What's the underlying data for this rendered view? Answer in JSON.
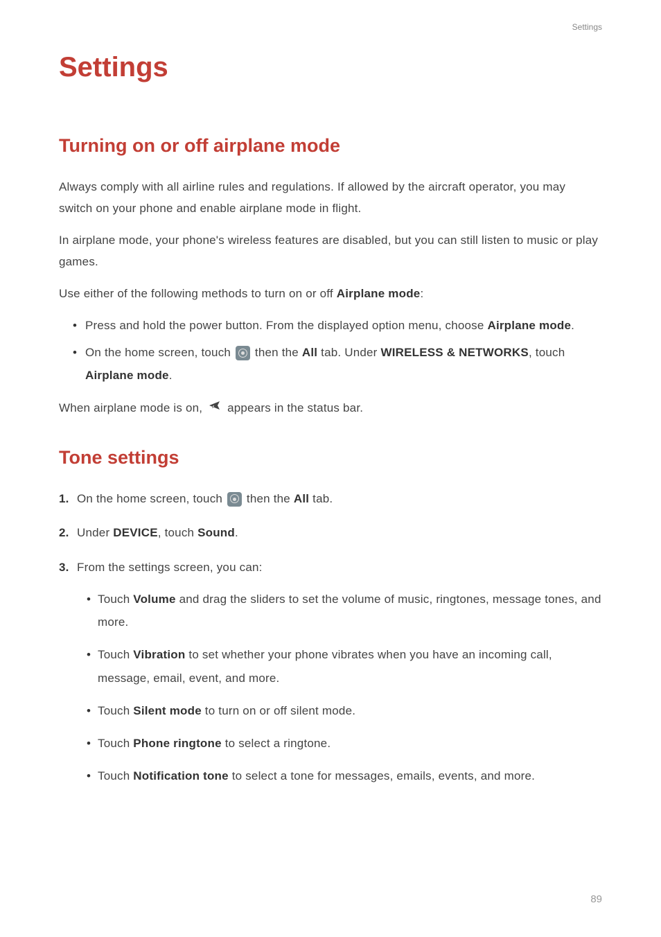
{
  "header": {
    "label": "Settings"
  },
  "title": "Settings",
  "section1": {
    "heading": "Turning on or off airplane mode",
    "p1": "Always comply with all airline rules and regulations. If allowed by the aircraft operator, you may switch on your phone and enable airplane mode in flight.",
    "p2": "In airplane mode, your phone's wireless features are disabled, but you can still listen to music or play games.",
    "p3_pre": "Use either of the following methods to turn on or off ",
    "p3_bold": "Airplane mode",
    "p3_post": ":",
    "bullet1_pre": "Press and hold the power button. From the displayed option menu, choose ",
    "bullet1_bold": "Airplane mode",
    "bullet1_post": ".",
    "bullet2_pre": "On the home screen, touch ",
    "bullet2_mid1": " then the ",
    "bullet2_bold1": "All",
    "bullet2_mid2": " tab. Under ",
    "bullet2_bold2": "WIRELESS & NETWORKS",
    "bullet2_mid3": ", touch ",
    "bullet2_bold3": "Airplane mode",
    "bullet2_post": ".",
    "p4_pre": "When airplane mode is on, ",
    "p4_post": " appears in the status bar."
  },
  "section2": {
    "heading": "Tone settings",
    "step1_num": "1. ",
    "step1_pre": "On the home screen, touch ",
    "step1_mid": " then the ",
    "step1_bold": "All",
    "step1_post": " tab.",
    "step2_num": "2. ",
    "step2_pre": "Under ",
    "step2_bold1": "DEVICE",
    "step2_mid": ", touch ",
    "step2_bold2": "Sound",
    "step2_post": ".",
    "step3_num": "3. ",
    "step3_text": "From the settings screen, you can:",
    "sub1_pre": "Touch ",
    "sub1_bold": "Volume",
    "sub1_post": " and drag the sliders to set the volume of music, ringtones, message tones, and more.",
    "sub2_pre": "Touch ",
    "sub2_bold": "Vibration",
    "sub2_post": " to set whether your phone vibrates when you have an incoming call, message, email, event, and more.",
    "sub3_pre": "Touch ",
    "sub3_bold": "Silent mode",
    "sub3_post": " to turn on or off silent mode.",
    "sub4_pre": "Touch ",
    "sub4_bold": "Phone ringtone",
    "sub4_post": " to select a ringtone.",
    "sub5_pre": "Touch ",
    "sub5_bold": "Notification tone",
    "sub5_post": " to select a tone for messages, emails, events, and more."
  },
  "pageNumber": "89"
}
